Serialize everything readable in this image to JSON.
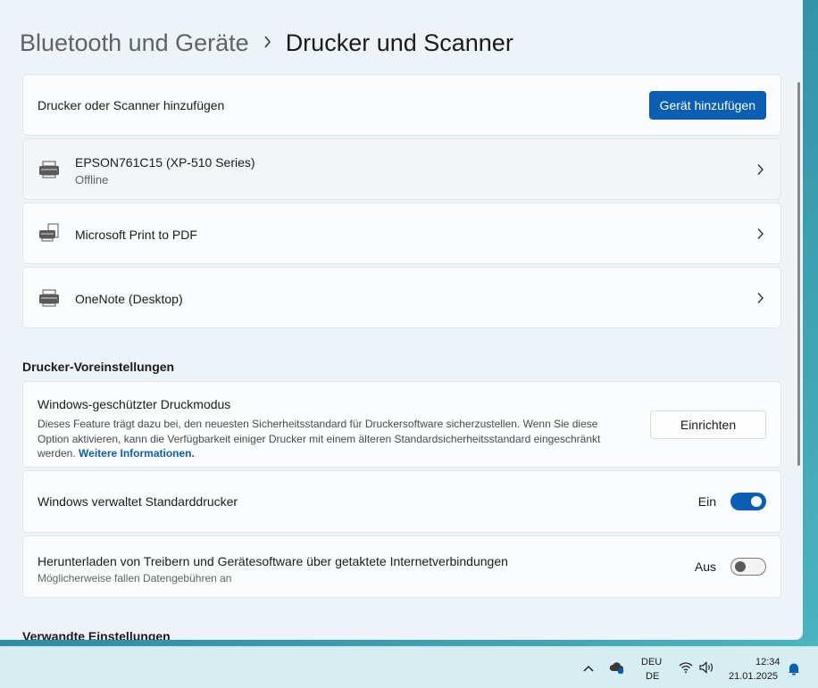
{
  "breadcrumb": {
    "parent": "Bluetooth und Geräte",
    "current": "Drucker und Scanner"
  },
  "add_device": {
    "label": "Drucker oder Scanner hinzufügen",
    "button_label": "Gerät hinzufügen"
  },
  "printers": [
    {
      "name": "EPSON761C15 (XP-510 Series)",
      "status": "Offline",
      "icon": "printer-icon"
    },
    {
      "name": "Microsoft Print to PDF",
      "icon": "printer-pdf-icon"
    },
    {
      "name": "OneNote (Desktop)",
      "icon": "printer-icon"
    }
  ],
  "preferences": {
    "title": "Drucker-Voreinstellungen",
    "protected_mode": {
      "label": "Windows-geschützter Druckmodus",
      "description": "Dieses Feature trägt dazu bei, den neuesten Sicherheitsstandard für Druckersoftware sicherzustellen. Wenn Sie diese Option aktivieren, kann die Verfügbarkeit einiger Drucker mit einem älteren Standardsicherheitsstandard eingeschränkt werden.",
      "link": "Weitere Informationen.",
      "button_label": "Einrichten"
    },
    "default_printer": {
      "label": "Windows verwaltet Standarddrucker",
      "state": "Ein",
      "on": true
    },
    "metered": {
      "label": "Herunterladen von Treibern und Gerätesoftware über getaktete Internetverbindungen",
      "sub": "Möglicherweise fallen Datengebühren an",
      "state": "Aus",
      "on": false
    }
  },
  "related": {
    "title": "Verwandte Einstellungen"
  },
  "taskbar": {
    "lang_top": "DEU",
    "lang_bottom": "DE",
    "time": "12:34",
    "date": "21.01.2025"
  },
  "colors": {
    "accent": "#0a5fb4",
    "window_bg": "#eef3f7"
  }
}
